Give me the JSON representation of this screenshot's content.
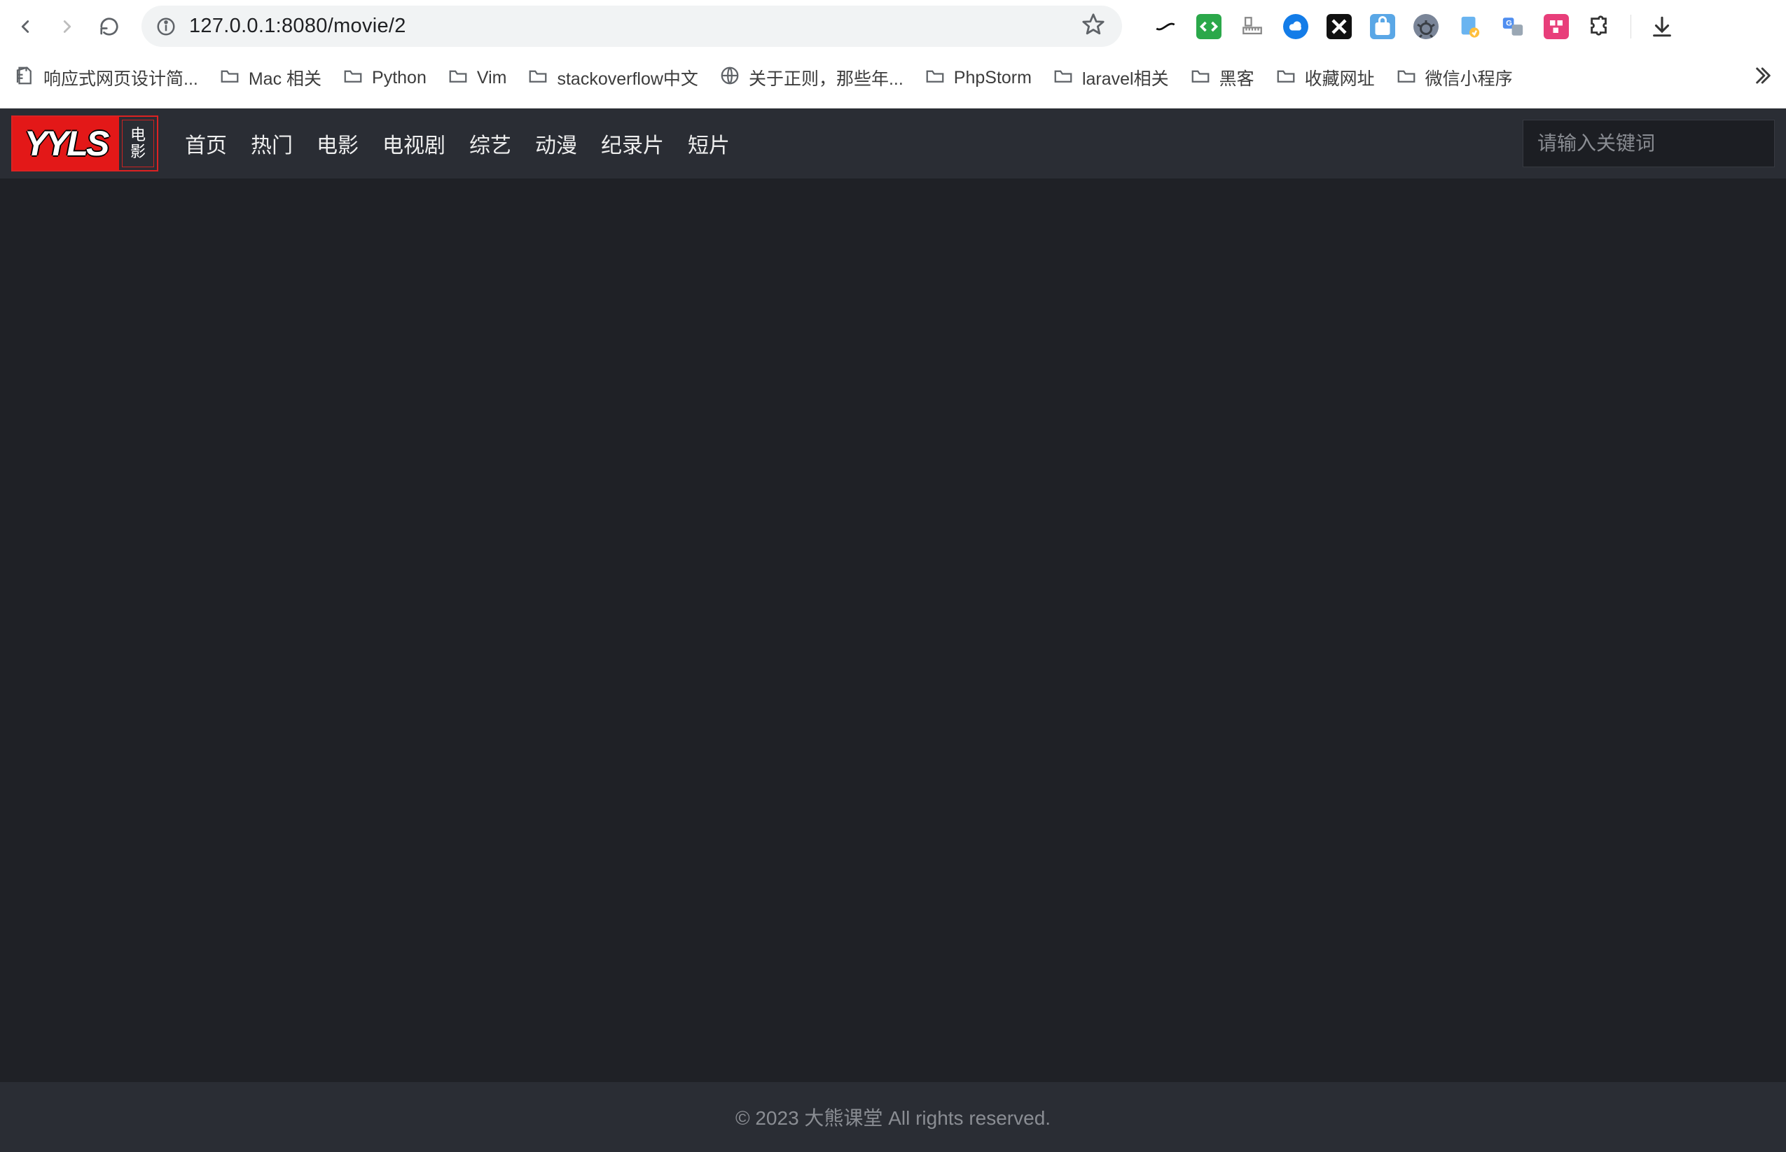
{
  "browser": {
    "url": "127.0.0.1:8080/movie/2",
    "bookmarks": [
      {
        "label": "响应式网页设计简...",
        "icon": "page"
      },
      {
        "label": "Mac 相关",
        "icon": "folder"
      },
      {
        "label": "Python",
        "icon": "folder"
      },
      {
        "label": "Vim",
        "icon": "folder"
      },
      {
        "label": "stackoverflow中文",
        "icon": "folder"
      },
      {
        "label": "关于正则，那些年...",
        "icon": "globe"
      },
      {
        "label": "PhpStorm",
        "icon": "folder"
      },
      {
        "label": "laravel相关",
        "icon": "folder"
      },
      {
        "label": "黑客",
        "icon": "folder"
      },
      {
        "label": "收藏网址",
        "icon": "folder"
      },
      {
        "label": "微信小程序",
        "icon": "folder"
      }
    ]
  },
  "site": {
    "logo_main": "YYLS",
    "logo_side_top": "电",
    "logo_side_bottom": "影",
    "nav": [
      "首页",
      "热门",
      "电影",
      "电视剧",
      "综艺",
      "动漫",
      "纪录片",
      "短片"
    ],
    "search_placeholder": "请输入关键词",
    "footer": "© 2023 大熊课堂 All rights reserved."
  }
}
